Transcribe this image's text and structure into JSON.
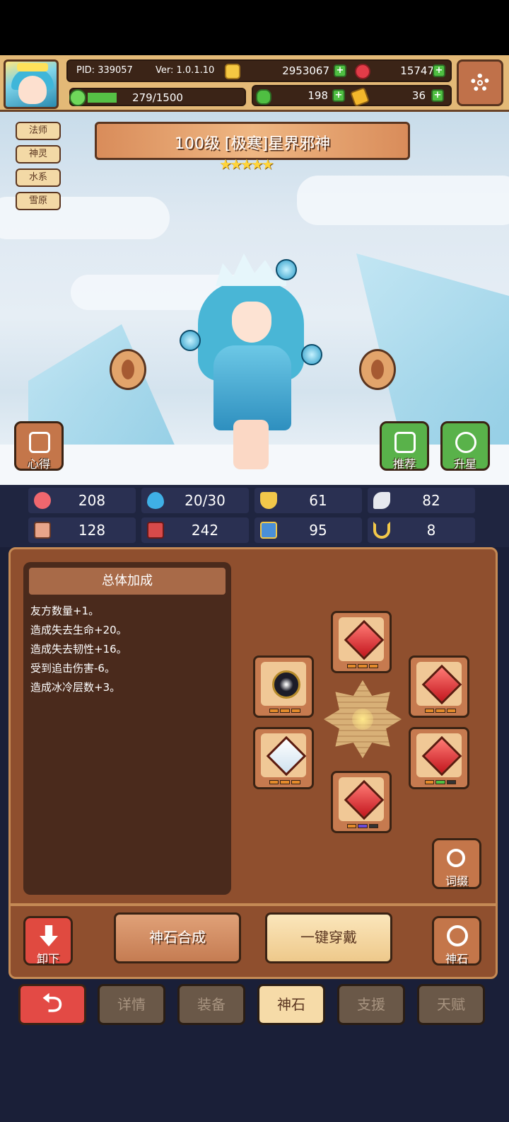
{
  "header": {
    "pid": "PID: 339057",
    "ver": "Ver: 1.0.1.10",
    "gold": "2953067",
    "gems": "15747",
    "energy": "279/1500",
    "clover": "198",
    "keys": "36",
    "energy_progress": 0.186
  },
  "tags": [
    "法师",
    "神灵",
    "水系",
    "雪原"
  ],
  "hero": {
    "title": "100级  [极寒]星界邪神",
    "stars": "★★★★★",
    "star_count": 5
  },
  "side_buttons": {
    "insight": "心得",
    "recommend": "推荐",
    "star_up": "升星"
  },
  "stats": [
    "208",
    "20/30",
    "61",
    "82",
    "128",
    "242",
    "95",
    "8"
  ],
  "bonus": {
    "title": "总体加成",
    "lines": [
      "友方数量+1。",
      "造成失去生命+20。",
      "造成失去韧性+16。",
      "受到追击伤害-6。",
      "造成冰冷层数+3。"
    ]
  },
  "actions": {
    "affix": "词缀",
    "unequip": "卸下",
    "synth": "神石合成",
    "equip_all": "一键穿戴",
    "godstone": "神石"
  },
  "nav": {
    "back": "⮌",
    "tabs": [
      "详情",
      "装备",
      "神石",
      "支援",
      "天赋"
    ],
    "active": "神石"
  },
  "colors": {
    "accent_red": "#e34a45",
    "panel_brown": "#8f4f2e",
    "header_tan": "#e3b977"
  }
}
